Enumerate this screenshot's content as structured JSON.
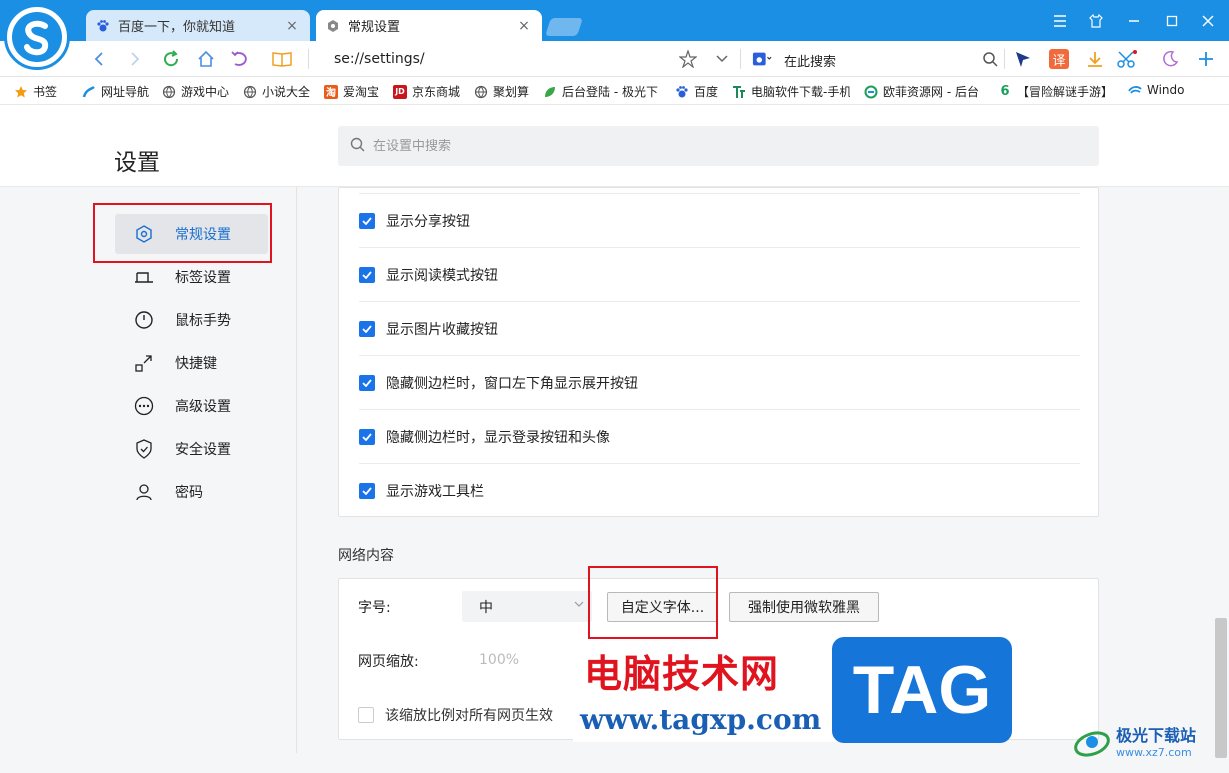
{
  "browser": {
    "tabs": [
      {
        "title": "百度一下，你就知道",
        "active": false,
        "icon": "baidu-paw-icon"
      },
      {
        "title": "常规设置",
        "active": true,
        "icon": "gear-icon"
      }
    ],
    "close_glyph": "×",
    "address": "se://settings/",
    "search_engine_placeholder": "在此搜索",
    "translate_label": "译",
    "accent_color": "#1a8fe3"
  },
  "bookmarks": [
    {
      "label": "书签",
      "icon": "star-icon"
    },
    {
      "label": "网址导航",
      "icon": "nav-icon"
    },
    {
      "label": "游戏中心",
      "icon": "globe-icon"
    },
    {
      "label": "小说大全",
      "icon": "globe-icon"
    },
    {
      "label": "爱淘宝",
      "icon": "taobao-icon",
      "glyph": "淘"
    },
    {
      "label": "京东商城",
      "icon": "jd-icon",
      "glyph": "JD"
    },
    {
      "label": "聚划算",
      "icon": "globe-icon"
    },
    {
      "label": "后台登陆 - 极光下",
      "icon": "leaf-icon"
    },
    {
      "label": "百度",
      "icon": "baidu-paw-icon"
    },
    {
      "label": "电脑软件下载-手机",
      "icon": "tf-icon"
    },
    {
      "label": "欧菲资源网 - 后台",
      "icon": "circle-e-icon"
    },
    {
      "label": "【冒险解谜手游】",
      "icon": "six-icon",
      "glyph": "6"
    },
    {
      "label": "Windo",
      "icon": "windows-icon"
    }
  ],
  "settings": {
    "title": "设置",
    "search_placeholder": "在设置中搜索",
    "sidebar": [
      {
        "label": "常规设置",
        "icon": "hexagon-gear-icon",
        "active": true
      },
      {
        "label": "标签设置",
        "icon": "tab-icon",
        "active": false
      },
      {
        "label": "鼠标手势",
        "icon": "mouse-icon",
        "active": false
      },
      {
        "label": "快捷键",
        "icon": "arrow-out-icon",
        "active": false
      },
      {
        "label": "高级设置",
        "icon": "more-circle-icon",
        "active": false
      },
      {
        "label": "安全设置",
        "icon": "shield-icon",
        "active": false
      },
      {
        "label": "密码",
        "icon": "user-icon",
        "active": false
      }
    ],
    "toolbar_options": [
      {
        "label": "显示分享按钮",
        "checked": true
      },
      {
        "label": "显示阅读模式按钮",
        "checked": true
      },
      {
        "label": "显示图片收藏按钮",
        "checked": true
      },
      {
        "label": "隐藏侧边栏时，窗口左下角显示展开按钮",
        "checked": true
      },
      {
        "label": "隐藏侧边栏时，显示登录按钮和头像",
        "checked": true
      },
      {
        "label": "显示游戏工具栏",
        "checked": true
      }
    ],
    "web_content": {
      "section_title": "网络内容",
      "font_size_label": "字号:",
      "font_size_value": "中",
      "custom_font_button": "自定义字体...",
      "force_yahei_button": "强制使用微软雅黑",
      "zoom_label": "网页缩放:",
      "zoom_value": "100%",
      "zoom_all_pages_label": "该缩放比例对所有网页生效",
      "zoom_all_pages_checked": false
    },
    "highlight_color": "#e0141e",
    "checkbox_color": "#1a73e8"
  },
  "watermark": {
    "site_name": "电脑技术网",
    "site_url": "www.tagxp.com",
    "tag_text": "TAG",
    "corner_name": "极光下载站",
    "corner_url": "www.xz7.com"
  }
}
